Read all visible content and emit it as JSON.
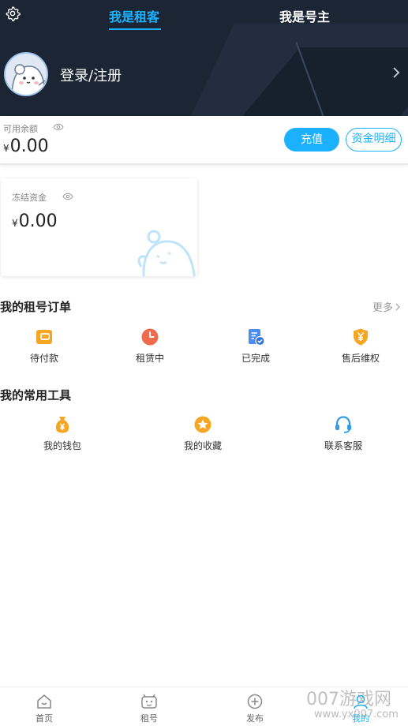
{
  "header": {
    "tabs": [
      {
        "label": "我是租客",
        "active": true
      },
      {
        "label": "我是号主",
        "active": false
      }
    ],
    "login_text": "登录/注册",
    "bg_color": "#1b2533",
    "accent_color": "#1cb1ff"
  },
  "balance": {
    "label": "可用余额",
    "currency": "¥",
    "amount": "0.00",
    "charge_button": "充值",
    "detail_button": "资金明细"
  },
  "frozen": {
    "label": "冻结资金",
    "currency": "¥",
    "amount": "0.00"
  },
  "orders": {
    "title": "我的租号订单",
    "more": "更多",
    "items": [
      {
        "label": "待付款",
        "icon": "wallet-card-icon"
      },
      {
        "label": "租赁中",
        "icon": "clock-icon"
      },
      {
        "label": "已完成",
        "icon": "completed-document-icon"
      },
      {
        "label": "售后维权",
        "icon": "shield-yen-icon"
      }
    ]
  },
  "tools": {
    "title": "我的常用工具",
    "items": [
      {
        "label": "我的钱包",
        "icon": "money-bag-icon"
      },
      {
        "label": "我的收藏",
        "icon": "star-icon"
      },
      {
        "label": "联系客服",
        "icon": "headset-icon"
      }
    ]
  },
  "bottom_nav": [
    {
      "label": "首页",
      "icon": "home-icon"
    },
    {
      "label": "租号",
      "icon": "gamepad-icon"
    },
    {
      "label": "发布",
      "icon": "plus-circle-icon"
    },
    {
      "label": "我的",
      "icon": "user-icon",
      "active": true
    }
  ],
  "watermark": {
    "top": "007游戏网",
    "bottom": "www.yx007.com"
  }
}
